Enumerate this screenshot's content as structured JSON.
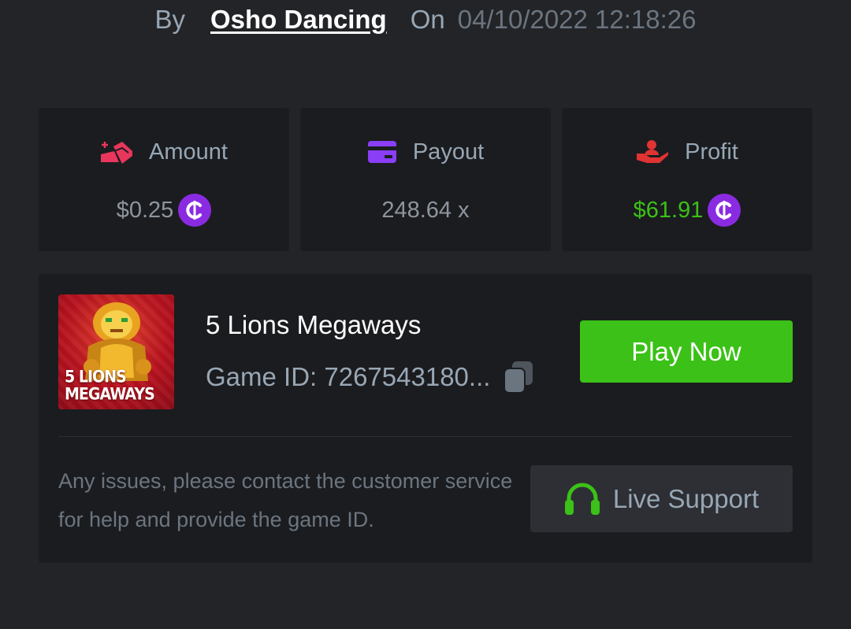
{
  "header": {
    "by_label": "By",
    "author": "Osho Dancing",
    "on_label": "On",
    "date": "04/10/2022 12:18:26"
  },
  "stats": {
    "amount": {
      "label": "Amount",
      "value": "$0.25",
      "icon": "coins-hand-icon",
      "icon_color": "#e8365c"
    },
    "payout": {
      "label": "Payout",
      "value": "248.64 x",
      "icon": "credit-card-icon",
      "icon_color": "#8a3ef6"
    },
    "profit": {
      "label": "Profit",
      "value": "$61.91",
      "icon": "hand-user-icon",
      "icon_color": "#e03333",
      "value_color": "#3bc117"
    }
  },
  "currency_icon": "coin-c-icon",
  "game": {
    "thumbnail_text_line1": "5 LIONS",
    "thumbnail_text_line2": "MEGAWAYS",
    "title": "5 Lions Megaways",
    "game_id": "Game ID: 7267543180...",
    "play_label": "Play Now"
  },
  "support": {
    "help_text": "Any issues, please contact the customer service for help and provide the game ID.",
    "button_label": "Live Support",
    "icon": "headset-icon"
  },
  "colors": {
    "background": "#232427",
    "card": "#1b1c1f",
    "accent_green": "#3bc117",
    "coin_purple": "#8a2be2"
  }
}
